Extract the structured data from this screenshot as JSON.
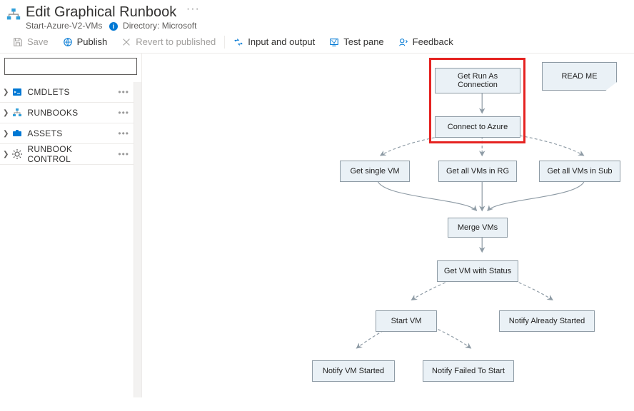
{
  "header": {
    "title": "Edit Graphical Runbook",
    "subtitle_name": "Start-Azure-V2-VMs",
    "directory_label": "Directory:",
    "directory_value": "Microsoft"
  },
  "toolbar": {
    "save": "Save",
    "publish": "Publish",
    "revert": "Revert to published",
    "io": "Input and output",
    "testpane": "Test pane",
    "feedback": "Feedback"
  },
  "sidebar": {
    "search_placeholder": "",
    "items": [
      {
        "label": "CMDLETS"
      },
      {
        "label": "RUNBOOKS"
      },
      {
        "label": "ASSETS"
      },
      {
        "label": "RUNBOOK CONTROL"
      }
    ],
    "more": "•••"
  },
  "flow": {
    "nodes": {
      "get_conn": "Get Run As Connection",
      "readme": "READ ME",
      "connect": "Connect to Azure",
      "single_vm": "Get single VM",
      "all_rg": "Get all VMs in RG",
      "all_sub": "Get all VMs in Sub",
      "merge": "Merge VMs",
      "status": "Get VM with Status",
      "start": "Start VM",
      "already": "Notify Already Started",
      "started": "Notify VM Started",
      "failed": "Notify Failed To Start"
    }
  }
}
